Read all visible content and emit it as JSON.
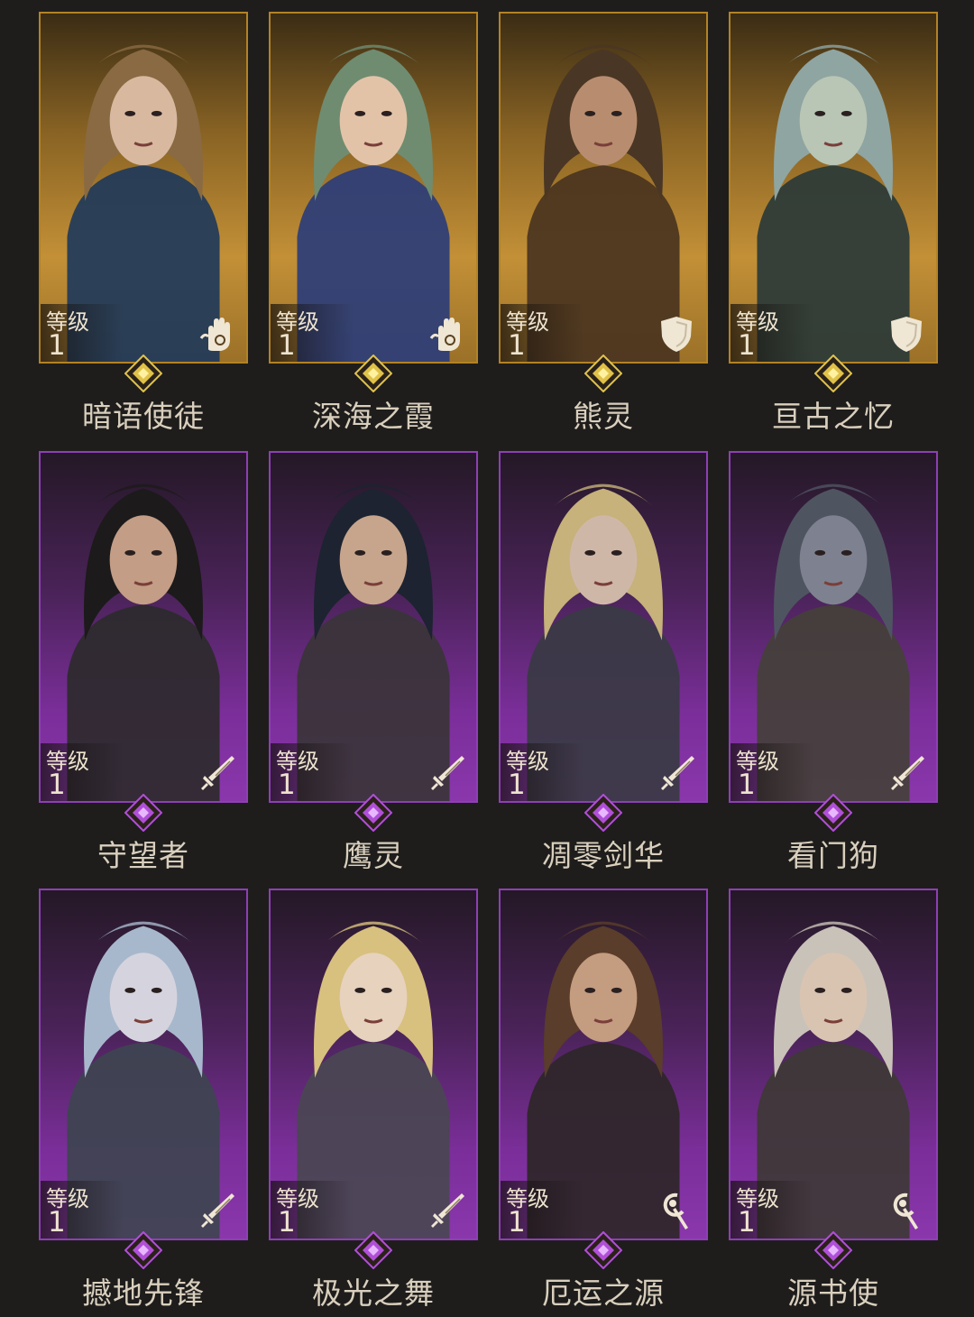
{
  "level_label": "等级",
  "colors": {
    "gold": "#c39037",
    "purple": "#7b2e9a",
    "text": "#d9cfbd"
  },
  "heroes": [
    {
      "name": "暗语使徒",
      "level": "1",
      "rarity": "gold",
      "class_icon": "hand-icon"
    },
    {
      "name": "深海之霞",
      "level": "1",
      "rarity": "gold",
      "class_icon": "hand-icon"
    },
    {
      "name": "熊灵",
      "level": "1",
      "rarity": "gold",
      "class_icon": "shield-icon"
    },
    {
      "name": "亘古之忆",
      "level": "1",
      "rarity": "gold",
      "class_icon": "shield-icon"
    },
    {
      "name": "守望者",
      "level": "1",
      "rarity": "purple",
      "class_icon": "sword-icon"
    },
    {
      "name": "鹰灵",
      "level": "1",
      "rarity": "purple",
      "class_icon": "sword-icon"
    },
    {
      "name": "凋零剑华",
      "level": "1",
      "rarity": "purple",
      "class_icon": "sword-icon"
    },
    {
      "name": "看门狗",
      "level": "1",
      "rarity": "purple",
      "class_icon": "sword-icon"
    },
    {
      "name": "撼地先锋",
      "level": "1",
      "rarity": "purple",
      "class_icon": "sword-icon"
    },
    {
      "name": "极光之舞",
      "level": "1",
      "rarity": "purple",
      "class_icon": "sword-icon"
    },
    {
      "name": "厄运之源",
      "level": "1",
      "rarity": "purple",
      "class_icon": "staff-icon"
    },
    {
      "name": "源书使",
      "level": "1",
      "rarity": "purple",
      "class_icon": "staff-icon"
    }
  ]
}
